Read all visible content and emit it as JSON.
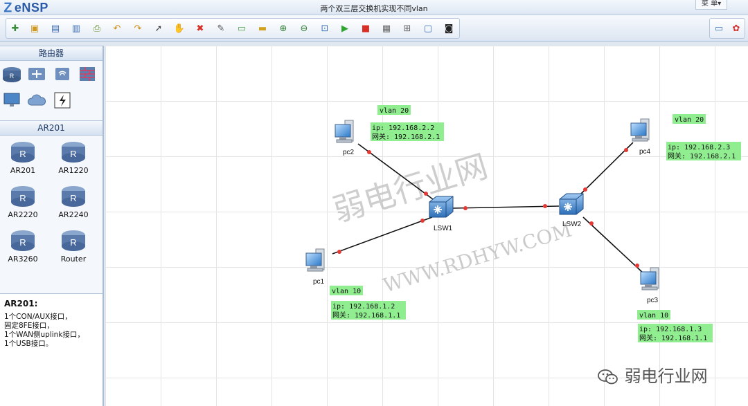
{
  "app": {
    "logo": "eNSP",
    "title": "两个双三层交换机实现不同vlan",
    "menu_label": "菜 单▾"
  },
  "toolbar": {
    "icons": [
      "new-topo-icon",
      "open-topo-icon",
      "save-icon",
      "save-as-icon",
      "print-icon",
      "undo-icon",
      "redo-icon",
      "select-icon",
      "pan-icon",
      "delete-icon",
      "delete-link-icon",
      "text-icon",
      "rectangle-icon",
      "zoom-in-icon",
      "zoom-out-icon",
      "fit-icon",
      "start-all-icon",
      "stop-all-icon",
      "capture-icon",
      "topology-icon",
      "screen-icon",
      "terminal-icon"
    ],
    "right_icons": [
      "chat-icon",
      "huawei-icon"
    ]
  },
  "sidebar": {
    "category_title": "路由器",
    "category_icons": [
      "router-cat-icon",
      "switch-cat-icon",
      "wlan-cat-icon",
      "firewall-cat-icon",
      "pc-cat-icon",
      "cloud-cat-icon",
      "other-cat-icon"
    ],
    "group_title": "AR201",
    "devices": [
      "AR201",
      "AR1220",
      "AR2220",
      "AR2240",
      "AR3260",
      "Router"
    ],
    "desc_title": "AR201:",
    "desc_lines": [
      "1个CON/AUX接口，",
      "固定8FE接口，",
      "1个WAN侧uplink接口，",
      "1个USB接口。"
    ]
  },
  "topology": {
    "devices": {
      "pc1": "pc1",
      "pc2": "pc2",
      "pc3": "pc3",
      "pc4": "pc4",
      "lsw1": "LSW1",
      "lsw2": "LSW2"
    },
    "labels": {
      "pc2_vlan": "vlan 20",
      "pc2_ip": "ip: 192.168.2.2",
      "pc2_gw": "网关: 192.168.2.1",
      "pc4_vlan": "vlan 20",
      "pc4_ip": "ip: 192.168.2.3",
      "pc4_gw": "网关: 192.168.2.1",
      "pc1_vlan": "vlan 10",
      "pc1_ip": "ip: 192.168.1.2",
      "pc1_gw": "网关: 192.168.1.1",
      "pc3_vlan": "vlan 10",
      "pc3_ip": "ip: 192.168.1.3",
      "pc3_gw": "网关: 192.168.1.1"
    },
    "watermark_cn": "弱电行业网",
    "watermark_url": "WWW.RDHYW.COM",
    "label_color": "#90ee90",
    "link_color": "#111111",
    "port_color": "#e53935"
  },
  "footer_watermark": "弱电行业网"
}
